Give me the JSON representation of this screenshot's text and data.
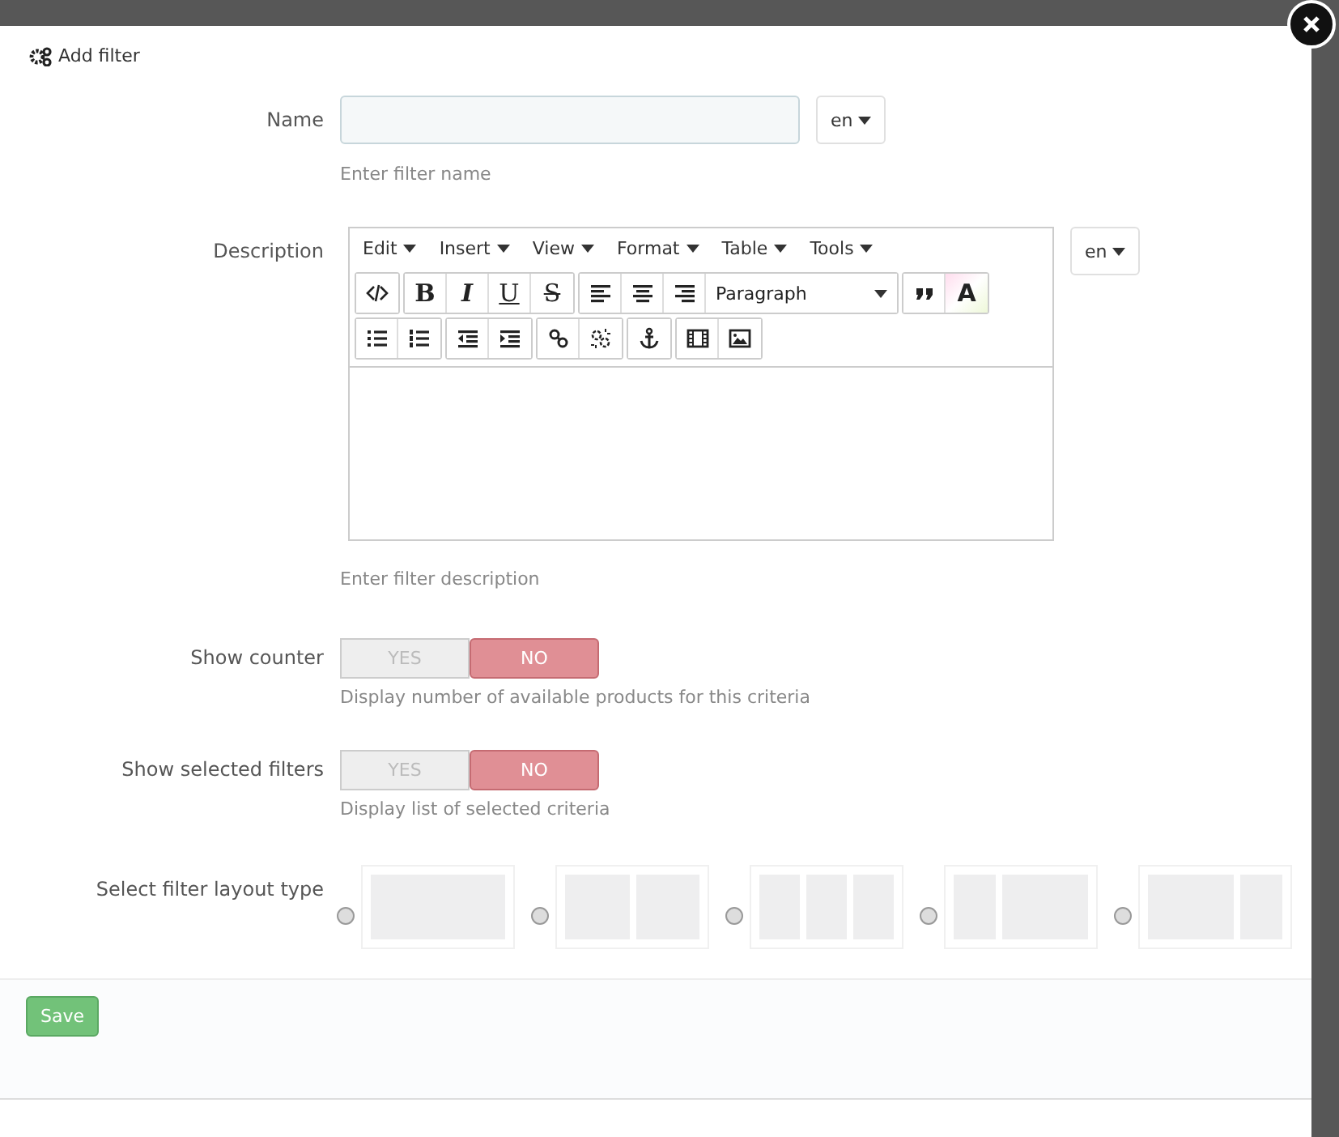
{
  "dialog": {
    "title": "Add filter"
  },
  "name_field": {
    "label": "Name",
    "language": "en",
    "help": "Enter filter name"
  },
  "description": {
    "label": "Description",
    "language": "en",
    "help": "Enter filter description",
    "menus": [
      "Edit",
      "Insert",
      "View",
      "Format",
      "Table",
      "Tools"
    ],
    "format_buttons": [
      "B",
      "I",
      "U",
      "S"
    ],
    "block_format": "Paragraph",
    "color_button": "A"
  },
  "toggles": [
    {
      "label": "Show counter",
      "help": "Display number of available products for this criteria",
      "options": [
        {
          "label": "YES",
          "selected": false
        },
        {
          "label": "NO",
          "selected": true
        }
      ]
    },
    {
      "label": "Show selected filters",
      "help": "Display list of selected criteria",
      "options": [
        {
          "label": "YES",
          "selected": false
        },
        {
          "label": "NO",
          "selected": true
        }
      ]
    }
  ],
  "layout_type": {
    "label": "Select filter layout type",
    "options": [
      {
        "kind": "one-column",
        "selected": false
      },
      {
        "kind": "two-columns",
        "selected": false
      },
      {
        "kind": "three-columns",
        "selected": false
      },
      {
        "kind": "left-sidebar",
        "selected": false
      },
      {
        "kind": "right-sidebar",
        "selected": false
      }
    ]
  },
  "buttons": [
    "Save"
  ]
}
